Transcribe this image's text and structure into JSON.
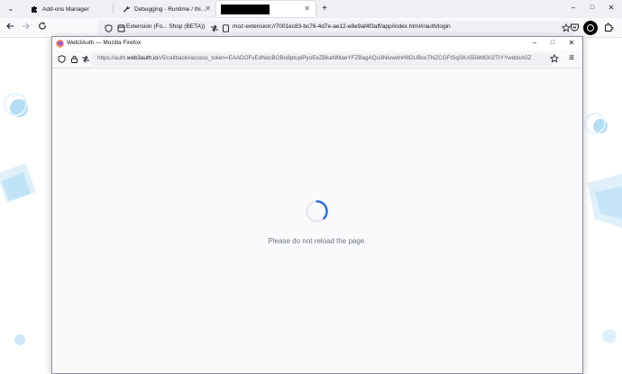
{
  "browser": {
    "tabs": [
      {
        "label": "Add-ons Manager",
        "icon": "puzzle-icon",
        "active": false
      },
      {
        "label": "Debugging - Runtime / this-fire",
        "icon": "wrench-icon",
        "active": false
      },
      {
        "label": "",
        "icon": "redacted-block",
        "active": true
      }
    ],
    "new_tab": "+",
    "window_controls": {
      "minimize": "–",
      "maximize": "□",
      "close": "✕"
    },
    "chevron": "⌄",
    "extension_name": "Extension (Fo... Shop (BETA))",
    "url": "moz-extension://7001ec83-bc76-4d7e-ae12-e8e9af4f3aff/app/index.html#/auth/login"
  },
  "popup": {
    "title": "Web3Auth — Mozilla Firefox",
    "url_prefix": "https://auth.",
    "url_domain": "web3auth.io",
    "url_rest": "/v5/callback#access_token=EAADOFvEdNocBOBo8ptupiPyoEeZBkaNMaeYFZBagAQu3NIuwdnH8DUBocTNZCGFtSqSKA556MG02TIYYwddxA0Z",
    "message": "Please do not reload the page.",
    "controls": {
      "minimize": "–",
      "maximize": "□",
      "close": "✕"
    },
    "menu": "≡"
  },
  "colors": {
    "spinner": "#1d66f0",
    "decor": "#b3ddf5"
  }
}
